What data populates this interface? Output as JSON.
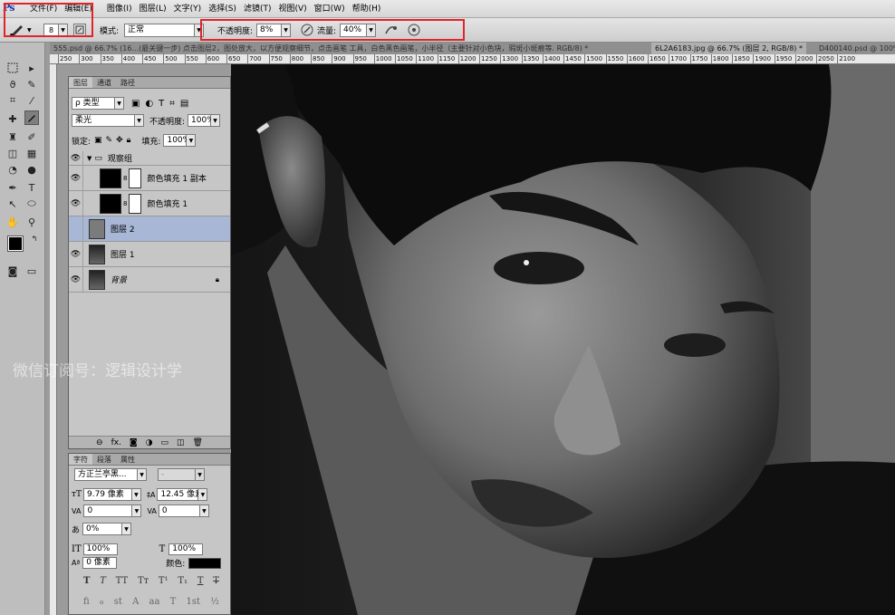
{
  "app": {
    "logo": "Ps"
  },
  "menu": [
    "文件(F)",
    "编辑(E)",
    "图像(I)",
    "图层(L)",
    "文字(Y)",
    "选择(S)",
    "滤镜(T)",
    "视图(V)",
    "窗口(W)",
    "帮助(H)"
  ],
  "options": {
    "brush_size": "8",
    "mode_label": "模式:",
    "mode_value": "正常",
    "opacity_label": "不透明度:",
    "opacity_value": "8%",
    "flow_label": "流量:",
    "flow_value": "40%"
  },
  "tabs": [
    "555.psd @ 66.7% (16...(最关键一步) 点击图层2，图处放大，以方便观察细节，点击画笔 工具，白色黑色画笔，小半径（主要针对小色块，瑕斑小斑痕等. RGB/8) *",
    "6L2A6183.jpg @ 66.7% (图层 2, RGB/8) *",
    "D400140.psd @ 100%"
  ],
  "ruler": [
    "250",
    "300",
    "350",
    "400",
    "450",
    "500",
    "550",
    "600",
    "650",
    "700",
    "750",
    "800",
    "850",
    "900",
    "950",
    "1000",
    "1050",
    "1100",
    "1150",
    "1200",
    "1250",
    "1300",
    "1350",
    "1400",
    "1450",
    "1500",
    "1550",
    "1600",
    "1650",
    "1700",
    "1750",
    "1800",
    "1850",
    "1900",
    "1950",
    "2000",
    "2050",
    "2100"
  ],
  "layers_panel": {
    "tabs": [
      "图层",
      "通道",
      "路径"
    ],
    "filter_label": "ρ 类型",
    "blend_mode": "柔光",
    "opacity_label": "不透明度:",
    "opacity_value": "100%",
    "lock_label": "锁定:",
    "fill_label": "填充:",
    "fill_value": "100%",
    "group_name": "观察组",
    "layers": [
      {
        "name": "颜色填充 1 副本",
        "selected": false
      },
      {
        "name": "颜色填充 1",
        "selected": false
      },
      {
        "name": "图层 2",
        "selected": true
      },
      {
        "name": "图层 1",
        "selected": false
      },
      {
        "name": "背景",
        "selected": false
      }
    ],
    "footer_fx": "fx."
  },
  "char_panel": {
    "tabs": [
      "字符",
      "段落",
      "属性"
    ],
    "font_family": "方正兰亭黑...",
    "font_style": "-",
    "size": "9.79 像素",
    "leading": "12.45 像素",
    "kerning": "0",
    "tracking": "0",
    "scale_pct": "0%",
    "v_scale": "100%",
    "h_scale": "100%",
    "baseline": "0 像素",
    "color_label": "颜色:",
    "style_glyphs": [
      "T",
      "T",
      "TT",
      "Tт",
      "T¹",
      "T₁",
      "T",
      "T"
    ],
    "ot_glyphs": [
      "fi",
      "ℴ",
      "st",
      "A",
      "aa",
      "T",
      "1st",
      "½"
    ]
  },
  "watermark": "微信订阅号：逻辑设计学",
  "colors": {
    "highlight": "#e0242c",
    "selected_layer": "#a8b7d6"
  }
}
